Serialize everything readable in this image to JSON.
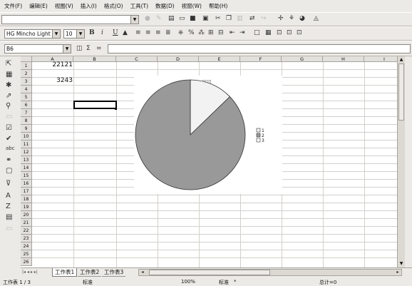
{
  "menu": [
    "文件(F)",
    "编辑(E)",
    "视图(V)",
    "插入(I)",
    "格式(O)",
    "工具(T)",
    "数据(D)",
    "视窗(W)",
    "帮助(H)"
  ],
  "formatting": {
    "font_name": "HG Mincho Light",
    "font_size": "10",
    "bold": "B",
    "italic": "i",
    "underline": "U"
  },
  "formula_bar": {
    "cell_ref": "B6",
    "sigma": "Σ",
    "equals": "="
  },
  "columns": [
    "A",
    "B",
    "C",
    "D",
    "E",
    "F",
    "G",
    "H",
    "I"
  ],
  "rows": [
    "1",
    "2",
    "3",
    "4",
    "5",
    "6",
    "7",
    "8",
    "9",
    "10",
    "11",
    "12",
    "13",
    "14",
    "15",
    "16",
    "17",
    "18",
    "19",
    "20",
    "21",
    "22",
    "23",
    "24",
    "25",
    "26"
  ],
  "cells": {
    "a1": "22121",
    "a3": "3243"
  },
  "chart_data": {
    "type": "pie",
    "title": "▯▯▯",
    "slices": [
      {
        "label": "1",
        "value": 3243,
        "color": "#f2f2f2"
      },
      {
        "label": "2",
        "value": 22121,
        "color": "#999999"
      },
      {
        "label": "3",
        "value": 0,
        "color": "#ffffff"
      }
    ],
    "legend": [
      "1",
      "2",
      "3"
    ],
    "legend_position": "right"
  },
  "sheets": {
    "tab1": "工作表1",
    "tab2": "工作表2",
    "tab3": "工作表3"
  },
  "status": {
    "sheet": "工作表 1 / 3",
    "style": "标准",
    "zoom": "100%",
    "mode": "标准",
    "star": "*",
    "sum": "总计=0"
  }
}
